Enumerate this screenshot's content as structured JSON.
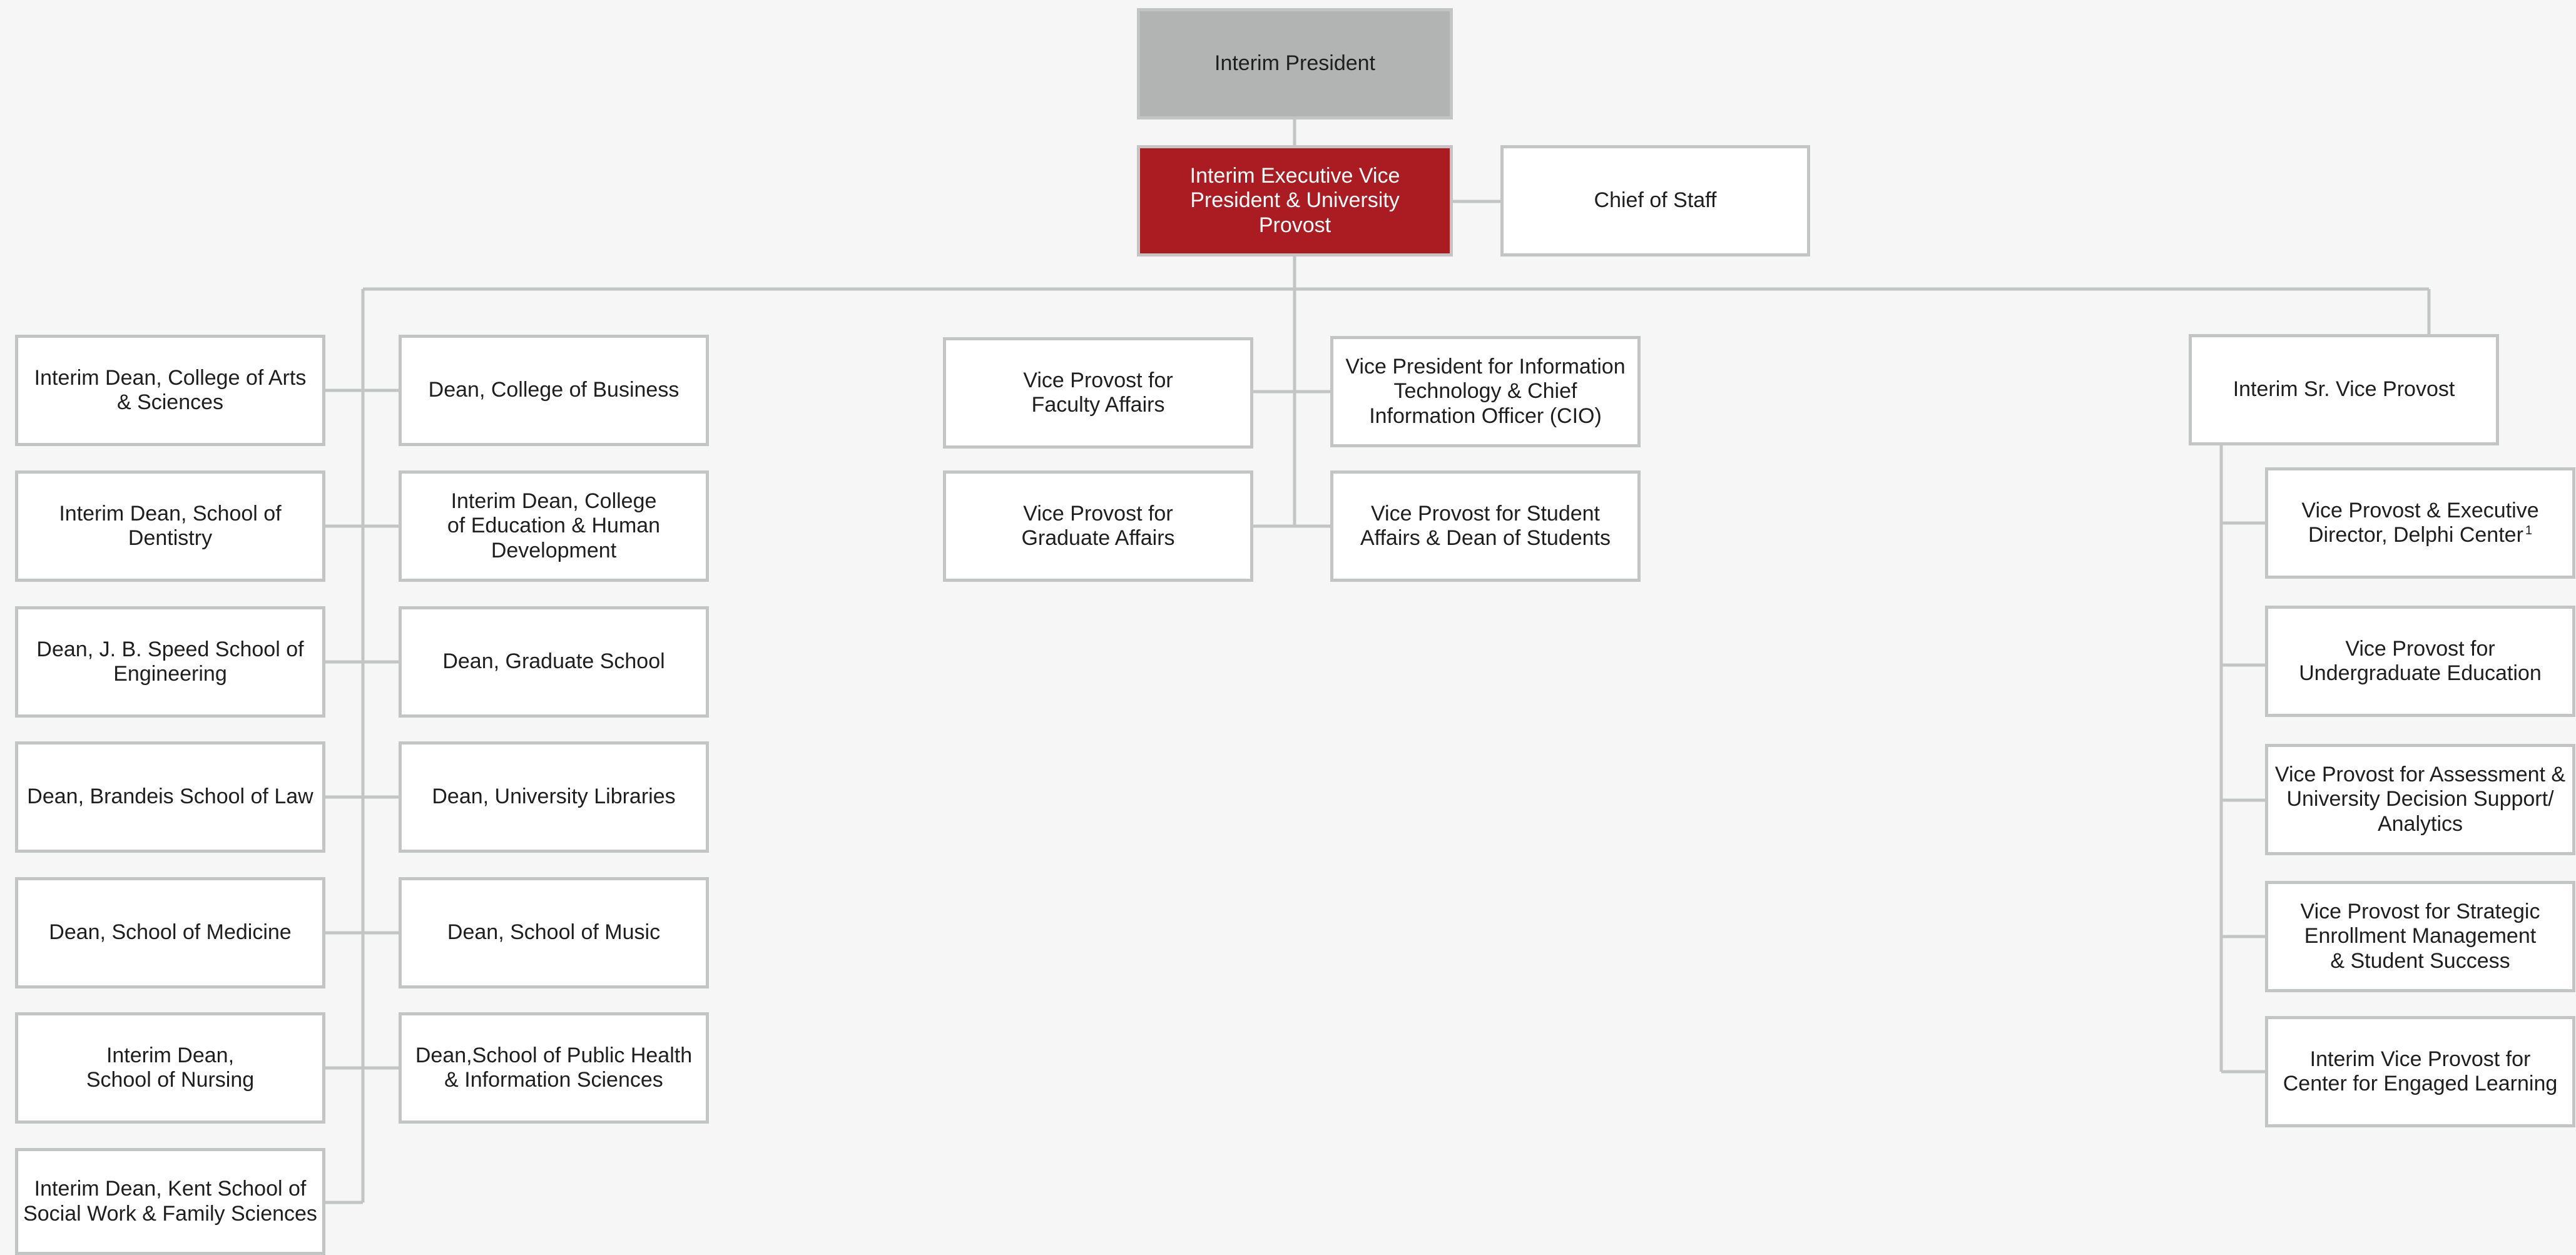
{
  "org_chart": {
    "president": "Interim President",
    "provost": "Interim Executive Vice\nPresident & University\nProvost",
    "chief_of_staff": "Chief of Staff",
    "deans_left": [
      "Interim Dean, College of Arts\n& Sciences",
      "Interim Dean, School of\nDentistry",
      "Dean, J. B. Speed School of\nEngineering",
      "Dean, Brandeis School of Law",
      "Dean, School of Medicine",
      "Interim Dean,\nSchool of Nursing",
      "Interim Dean, Kent School of\nSocial Work & Family Sciences"
    ],
    "deans_right": [
      "Dean, College of Business",
      "Interim Dean, College\nof Education & Human\nDevelopment",
      "Dean, Graduate School",
      "Dean, University Libraries",
      "Dean, School of Music",
      "Dean,School of Public Health\n& Information Sciences"
    ],
    "center_left": [
      "Vice Provost for\nFaculty Affairs",
      "Vice Provost for\nGraduate Affairs"
    ],
    "center_right": [
      "Vice President for Information\nTechnology & Chief\nInformation Officer (CIO)",
      "Vice Provost for Student\nAffairs & Dean of Students"
    ],
    "senior_vp": "Interim Sr. Vice Provost",
    "senior_vp_reports": [
      "Vice Provost & Executive\nDirector, Delphi Center",
      "Vice Provost for\nUndergraduate Education",
      "Vice Provost for Assessment &\nUniversity Decision Support/\nAnalytics",
      "Vice Provost for Strategic\nEnrollment Management\n& Student Success",
      "Interim Vice Provost for\nCenter for Engaged Learning"
    ],
    "delphi_footnote": "1"
  },
  "colors": {
    "background": "#f5f6f5",
    "box_border": "#c3c5c4",
    "president_fill": "#b2b4b3",
    "provost_fill": "#ab1c22",
    "connector": "#c3c5c4"
  }
}
